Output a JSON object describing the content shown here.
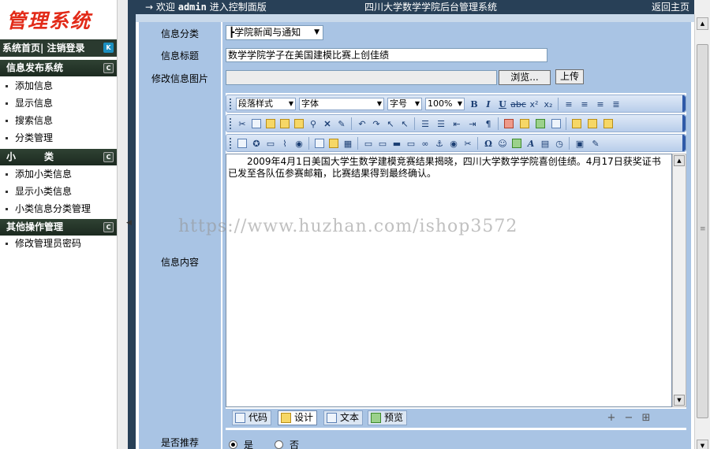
{
  "sidebar": {
    "logo_text": "管理系统",
    "topnav_label": "系统首页| 注销登录",
    "topnav_btn": "K",
    "sections": [
      {
        "title": "信息发布系统",
        "btn": "C",
        "items": [
          "添加信息",
          "显示信息",
          "搜索信息",
          "分类管理"
        ]
      },
      {
        "title": "小　　　类",
        "btn": "C",
        "items": [
          "添加小类信息",
          "显示小类信息",
          "小类信息分类管理"
        ]
      },
      {
        "title": "其他操作管理",
        "btn": "C",
        "items": [
          "修改管理员密码"
        ]
      }
    ]
  },
  "topbar": {
    "arrow": "→",
    "welcome_prefix": "欢迎",
    "username": "admin",
    "welcome_suffix": "进入控制面版",
    "system_title": "四川大学数学学院后台管理系统",
    "home_link": "返回主页"
  },
  "form": {
    "category": {
      "label": "信息分类",
      "value": "┣学院新闻与通知"
    },
    "title": {
      "label": "信息标题",
      "value": "数学学院学子在美国建模比赛上创佳绩"
    },
    "image": {
      "label": "修改信息图片",
      "browse_label": "浏览...",
      "upload_label": "上传"
    },
    "content": {
      "label": "信息内容"
    },
    "recommend": {
      "label": "是否推荐",
      "yes_label": "是",
      "no_label": "否"
    }
  },
  "editor": {
    "selects": {
      "paragraph": "段落样式",
      "font": "字体",
      "size": "字号",
      "zoom": "100%"
    },
    "content_text": "2009年4月1日美国大学生数学建模竞赛结果揭晓，四川大学数学学院喜创佳绩。4月17日获奖证书已发至各队伍参赛邮箱，比赛结果得到最终确认。",
    "modes": {
      "code": "代码",
      "design": "设计",
      "text": "文本",
      "preview": "预览"
    }
  },
  "watermark": "https://www.huzhan.com/ishop3572"
}
